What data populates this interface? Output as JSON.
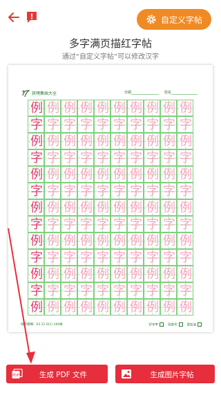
{
  "header": {
    "back_icon": "arrow-left-icon",
    "report_icon": "report-icon",
    "custom_button_label": "自定义字帖",
    "custom_button_icon": "gear-icon"
  },
  "title": "多字满页描红字帖",
  "subtitle": "通过“自定义字帖”可以修改汉字",
  "sheet": {
    "brand": "其嘿集画大全",
    "date_label": "日期",
    "name_label": "姓名",
    "characters": [
      "例",
      "字"
    ],
    "columns": 10,
    "rows": 13,
    "footer_left": "线条粗细：03   21.0(1)-160格",
    "footer_right": [
      "好字率",
      "周度号",
      "要加油"
    ]
  },
  "buttons": {
    "pdf_label": "生成 PDF 文件",
    "image_label": "生成图片字帖"
  },
  "colors": {
    "accent_red": "#e62e3c",
    "accent_orange": "#f08a24",
    "grid_green": "#7fcf7f",
    "trace_pink": "#f6a6bf",
    "char_red": "#e63e74"
  }
}
